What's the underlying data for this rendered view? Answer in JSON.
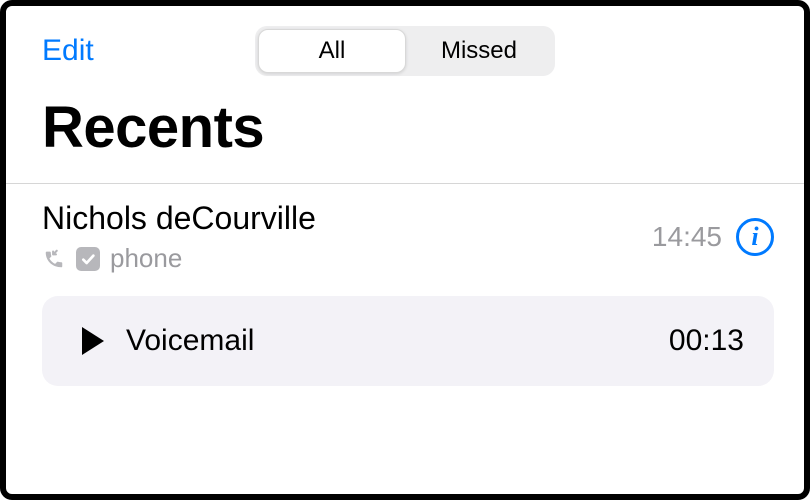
{
  "header": {
    "edit_label": "Edit",
    "segments": {
      "all": "All",
      "missed": "Missed"
    }
  },
  "title": "Recents",
  "call": {
    "contact_name": "Nichols deCourville",
    "type_label": "phone",
    "timestamp": "14:45"
  },
  "voicemail": {
    "label": "Voicemail",
    "duration": "00:13"
  }
}
